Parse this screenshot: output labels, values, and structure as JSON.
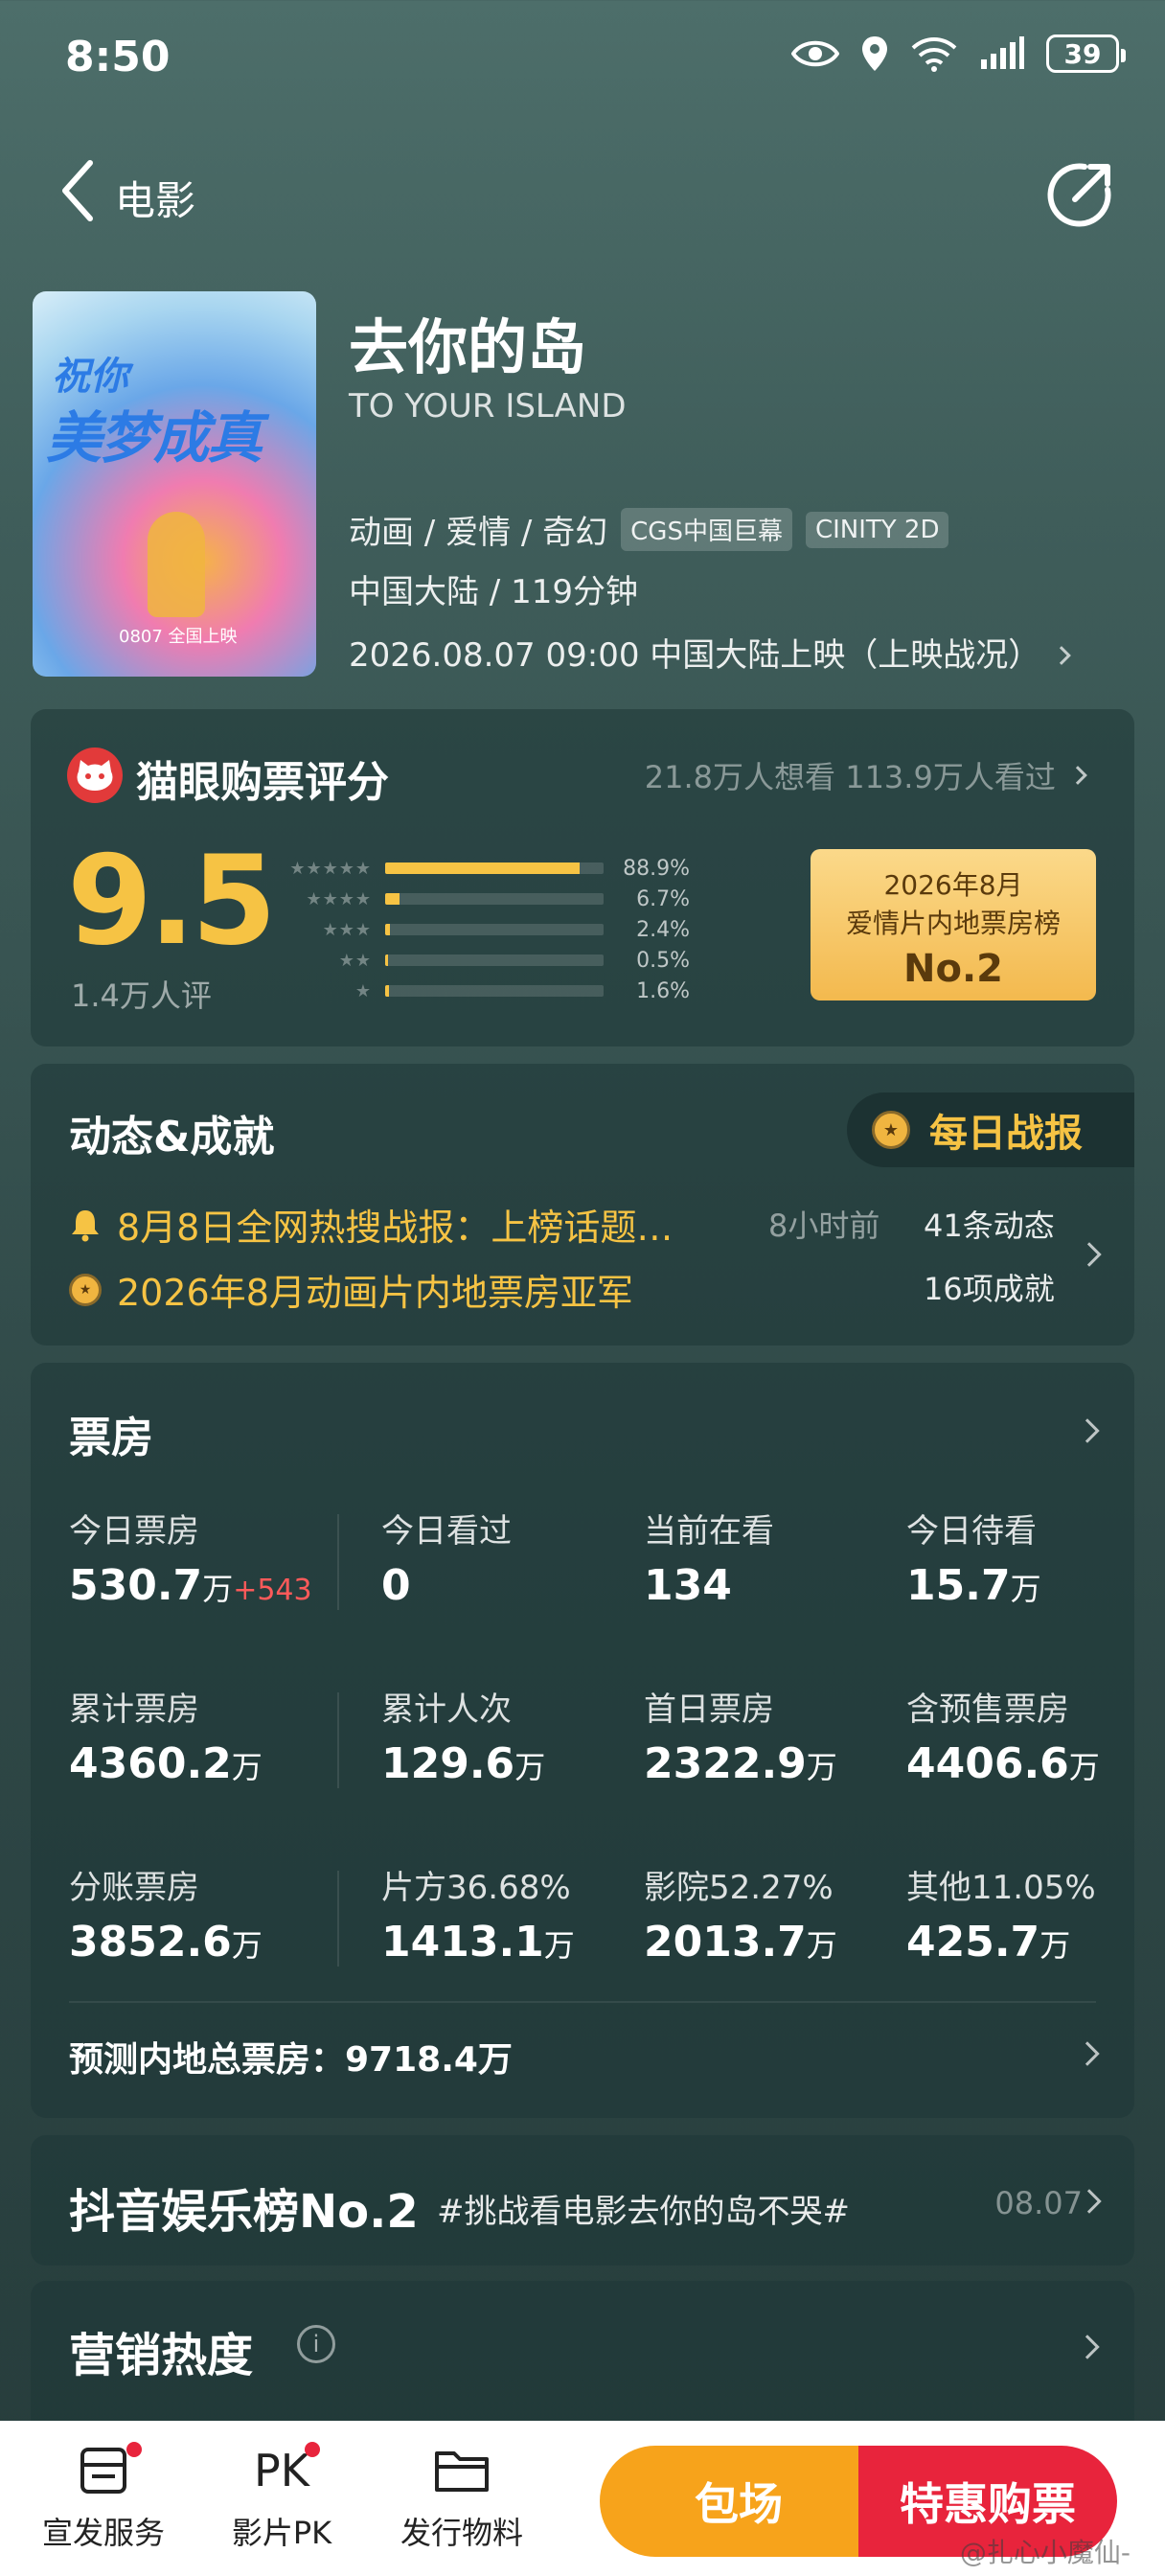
{
  "status_bar": {
    "time": "8:50",
    "battery": "39"
  },
  "nav": {
    "back_label": "电影"
  },
  "movie": {
    "poster_text1": "祝你",
    "poster_text2": "美梦成真",
    "poster_footer": "0807 全国上映",
    "title": "去你的岛",
    "title_en": "TO YOUR ISLAND",
    "genre": "动画 / 爱情 / 奇幻",
    "tags": [
      "CGS中国巨幕",
      "CINITY 2D"
    ],
    "region_duration": "中国大陆 / 119分钟",
    "release": "2026.08.07 09:00 中国大陆上映（上映战况）"
  },
  "rating": {
    "label": "猫眼购票评分",
    "want_watched": "21.8万人想看 113.9万人看过",
    "score": "9.5",
    "count": "1.4万人评",
    "distribution": [
      {
        "stars": "★★★★★",
        "pct": "88.9%",
        "value": 0.889
      },
      {
        "stars": "★★★★",
        "pct": "6.7%",
        "value": 0.067
      },
      {
        "stars": "★★★",
        "pct": "2.4%",
        "value": 0.024
      },
      {
        "stars": "★★",
        "pct": "0.5%",
        "value": 0.005
      },
      {
        "stars": "★",
        "pct": "1.6%",
        "value": 0.016
      }
    ],
    "rank_line1": "2026年8月",
    "rank_line2": "爱情片内地票房榜",
    "rank_no": "No.2"
  },
  "dynamics": {
    "title": "动态&成就",
    "daily_report": "每日战报",
    "item1": "8月8日全网热搜战报：上榜话题…",
    "item1_time": "8小时前",
    "item1_count": "41条动态",
    "item2": "2026年8月动画片内地票房亚军",
    "item2_count": "16项成就"
  },
  "box_office": {
    "title": "票房",
    "stats": [
      {
        "label": "今日票房",
        "value": "530.7",
        "unit": "万",
        "delta": "+543"
      },
      {
        "label": "今日看过",
        "value": "0",
        "unit": "",
        "delta": ""
      },
      {
        "label": "当前在看",
        "value": "134",
        "unit": "",
        "delta": ""
      },
      {
        "label": "今日待看",
        "value": "15.7",
        "unit": "万",
        "delta": ""
      },
      {
        "label": "累计票房",
        "value": "4360.2",
        "unit": "万",
        "delta": ""
      },
      {
        "label": "累计人次",
        "value": "129.6",
        "unit": "万",
        "delta": ""
      },
      {
        "label": "首日票房",
        "value": "2322.9",
        "unit": "万",
        "delta": ""
      },
      {
        "label": "含预售票房",
        "value": "4406.6",
        "unit": "万",
        "delta": ""
      },
      {
        "label": "分账票房",
        "value": "3852.6",
        "unit": "万",
        "delta": ""
      },
      {
        "label": "片方36.68%",
        "value": "1413.1",
        "unit": "万",
        "delta": ""
      },
      {
        "label": "影院52.27%",
        "value": "2013.7",
        "unit": "万",
        "delta": ""
      },
      {
        "label": "其他11.05%",
        "value": "425.7",
        "unit": "万",
        "delta": ""
      }
    ],
    "forecast": "预测内地总票房：9718.4万"
  },
  "douyin": {
    "title": "抖音娱乐榜No.2",
    "tag": "#挑战看电影去你的岛不哭#",
    "date": "08.07"
  },
  "marketing": {
    "title": "营销热度",
    "info": "i"
  },
  "bottom_bar": {
    "items": [
      {
        "label": "宣发服务"
      },
      {
        "label": "影片PK",
        "icon_text": "PK"
      },
      {
        "label": "发行物料"
      }
    ],
    "charter": "包场",
    "buy": "特惠购票",
    "watermark": "@扎心小魔仙-"
  },
  "colors": {
    "accent": "#f6c344",
    "buy": "#e8243c",
    "charter": "#f7a31b",
    "up": "#ff5a5a"
  }
}
